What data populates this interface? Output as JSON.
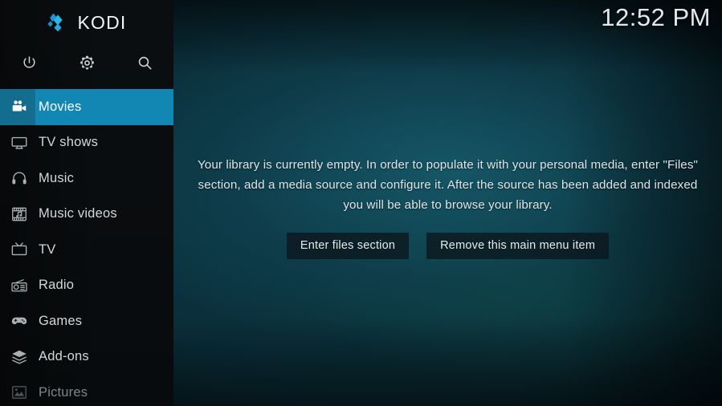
{
  "app": {
    "name": "KODI",
    "logo_icon": "kodi-logo-icon",
    "accent_color": "#1287b3",
    "accent_dark_color": "#136d8f",
    "background_color": "#0a2b36"
  },
  "header": {
    "clock": "12:52 PM"
  },
  "toolbar": {
    "buttons": [
      {
        "label": "Power",
        "icon": "power-icon"
      },
      {
        "label": "Settings",
        "icon": "gear-icon"
      },
      {
        "label": "Search",
        "icon": "search-icon"
      }
    ]
  },
  "sidebar": {
    "items": [
      {
        "label": "Movies",
        "icon": "movie-camera-icon",
        "selected": true,
        "dim": false
      },
      {
        "label": "TV shows",
        "icon": "monitor-icon",
        "selected": false,
        "dim": false
      },
      {
        "label": "Music",
        "icon": "headphones-icon",
        "selected": false,
        "dim": false
      },
      {
        "label": "Music videos",
        "icon": "film-note-icon",
        "selected": false,
        "dim": false
      },
      {
        "label": "TV",
        "icon": "tv-set-icon",
        "selected": false,
        "dim": false
      },
      {
        "label": "Radio",
        "icon": "radio-icon",
        "selected": false,
        "dim": false
      },
      {
        "label": "Games",
        "icon": "gamepad-icon",
        "selected": false,
        "dim": false
      },
      {
        "label": "Add-ons",
        "icon": "addons-box-icon",
        "selected": false,
        "dim": false
      },
      {
        "label": "Pictures",
        "icon": "picture-icon",
        "selected": false,
        "dim": true
      }
    ]
  },
  "main": {
    "empty_message": "Your library is currently empty. In order to populate it with your personal media, enter \"Files\" section, add a media source and configure it. After the source has been added and indexed you will be able to browse your library.",
    "buttons": [
      {
        "label": "Enter files section"
      },
      {
        "label": "Remove this main menu item"
      }
    ]
  }
}
